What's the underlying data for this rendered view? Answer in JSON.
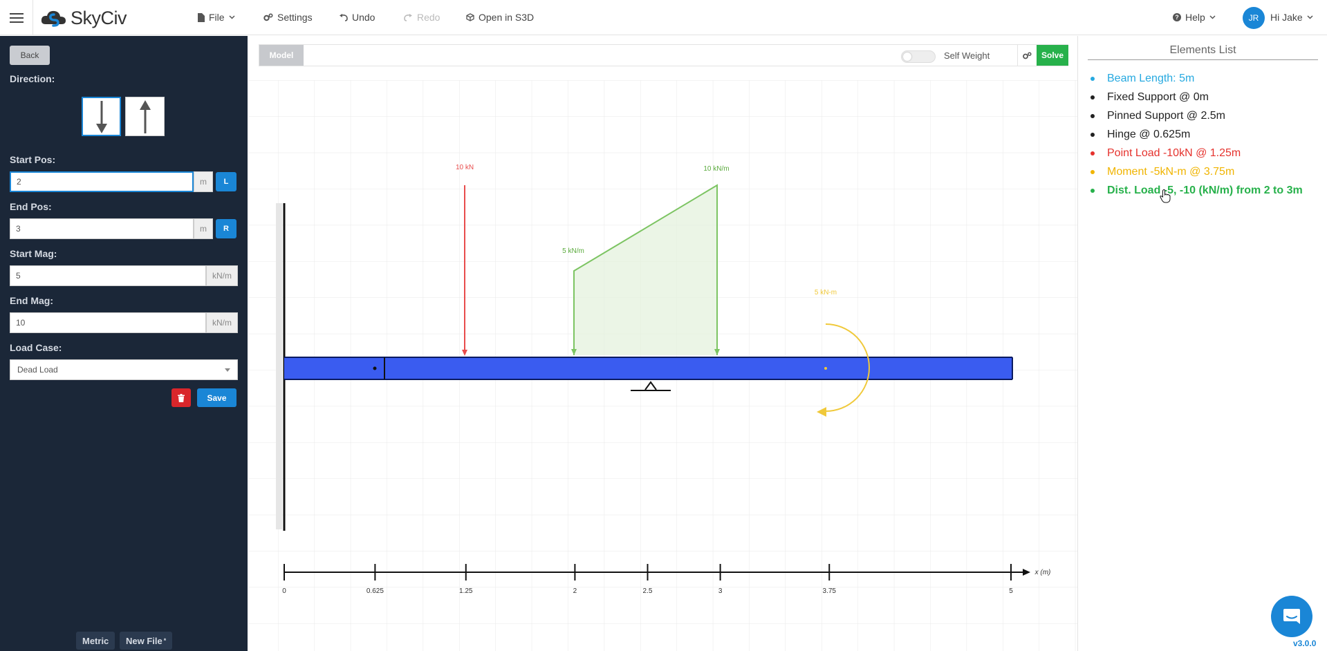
{
  "app": {
    "brand": "SkyCiv",
    "version": "v3.0.0"
  },
  "topbar": {
    "file_label": "File",
    "settings_label": "Settings",
    "undo_label": "Undo",
    "redo_label": "Redo",
    "open_s3d_label": "Open in S3D",
    "help_label": "Help",
    "user_initials": "JR",
    "user_greeting": "Hi Jake"
  },
  "leftpanel": {
    "back_label": "Back",
    "direction_label": "Direction:",
    "start_pos_label": "Start Pos:",
    "start_pos_value": "2",
    "start_pos_unit": "m",
    "start_pos_side": "L",
    "end_pos_label": "End Pos:",
    "end_pos_value": "3",
    "end_pos_unit": "m",
    "end_pos_side": "R",
    "start_mag_label": "Start Mag:",
    "start_mag_value": "5",
    "start_mag_unit": "kN/m",
    "end_mag_label": "End Mag:",
    "end_mag_value": "10",
    "end_mag_unit": "kN/m",
    "load_case_label": "Load Case:",
    "load_case_value": "Dead Load",
    "save_label": "Save",
    "footer_metric": "Metric",
    "footer_newfile": "New File",
    "footer_newfile_mark": "*"
  },
  "canvas": {
    "model_tab": "Model",
    "self_weight_label": "Self Weight",
    "solve_label": "Solve",
    "point_load_label": "10 kN",
    "dist_start_label": "5 kN/m",
    "dist_end_label": "10 kN/m",
    "moment_label": "5 kN-m",
    "axis_label": "x (m)",
    "ticks": [
      "0",
      "0.625",
      "1.25",
      "2",
      "2.5",
      "3",
      "3.75",
      "5"
    ]
  },
  "colors": {
    "beam": "#3a5cf0",
    "point_load": "#e84b4b",
    "dist_load": "#7cc462",
    "moment": "#f0c93a",
    "accent": "#1a86d6",
    "solve": "#27b14b"
  },
  "elements_list": {
    "title": "Elements List",
    "items": [
      {
        "text": "Beam Length: 5m",
        "color": "#26a9e0"
      },
      {
        "text": "Fixed Support @ 0m",
        "color": "#222222"
      },
      {
        "text": "Pinned Support @ 2.5m",
        "color": "#222222"
      },
      {
        "text": "Hinge @ 0.625m",
        "color": "#222222"
      },
      {
        "text": "Point Load -10kN @ 1.25m",
        "color": "#e5322d"
      },
      {
        "text": "Moment -5kN-m @ 3.75m",
        "color": "#f0b400"
      },
      {
        "text": "Dist. Load -5, -10 (kN/m) from 2 to 3m",
        "color": "#27b14b"
      }
    ]
  }
}
